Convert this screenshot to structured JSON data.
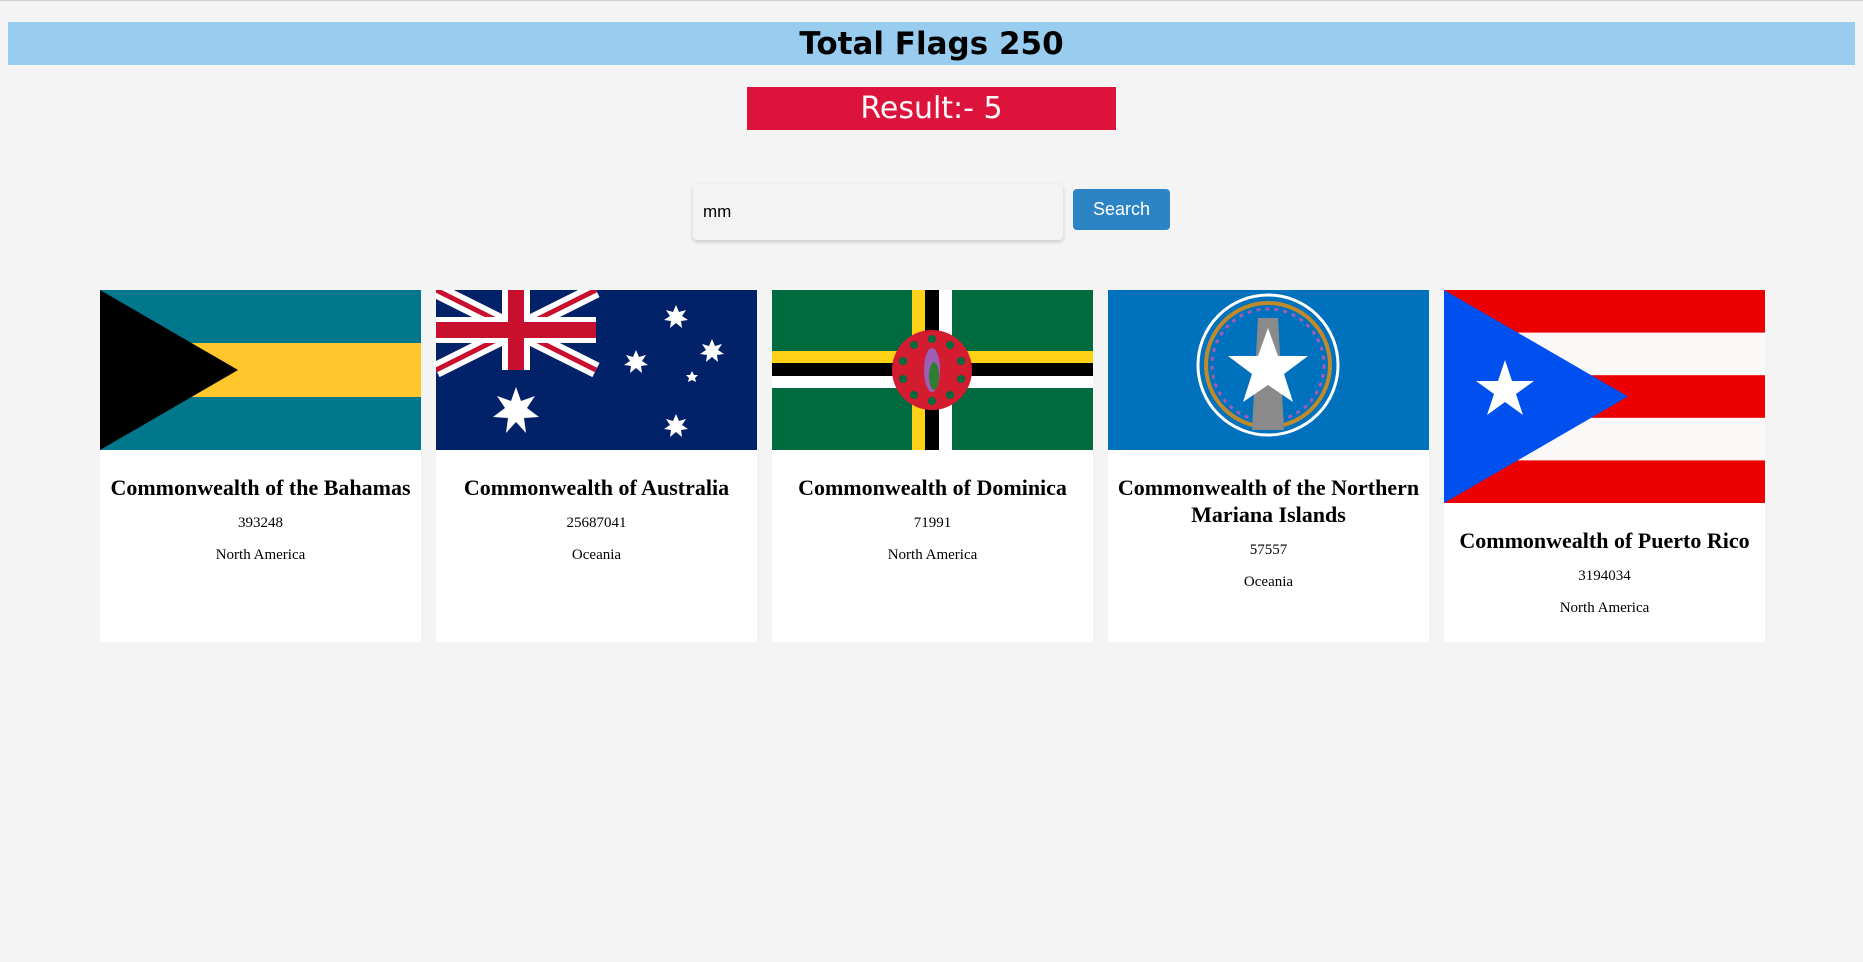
{
  "header": {
    "title": "Total Flags 250"
  },
  "result": {
    "label": "Result:- 5"
  },
  "search": {
    "value": "mm",
    "button_label": "Search"
  },
  "countries": [
    {
      "name": "Commonwealth of the Bahamas",
      "population": "393248",
      "region": "North America",
      "flag": "bahamas-flag"
    },
    {
      "name": "Commonwealth of Australia",
      "population": "25687041",
      "region": "Oceania",
      "flag": "australia-flag"
    },
    {
      "name": "Commonwealth of Dominica",
      "population": "71991",
      "region": "North America",
      "flag": "dominica-flag"
    },
    {
      "name": "Commonwealth of the Northern Mariana Islands",
      "population": "57557",
      "region": "Oceania",
      "flag": "northern-mariana-islands-flag"
    },
    {
      "name": "Commonwealth of Puerto Rico",
      "population": "3194034",
      "region": "North America",
      "flag": "puerto-rico-flag"
    }
  ],
  "colors": {
    "header_bg": "#99cdf0",
    "result_bg": "#dc143c",
    "button_bg": "#2d84c4",
    "page_bg": "#f4f4f4"
  }
}
